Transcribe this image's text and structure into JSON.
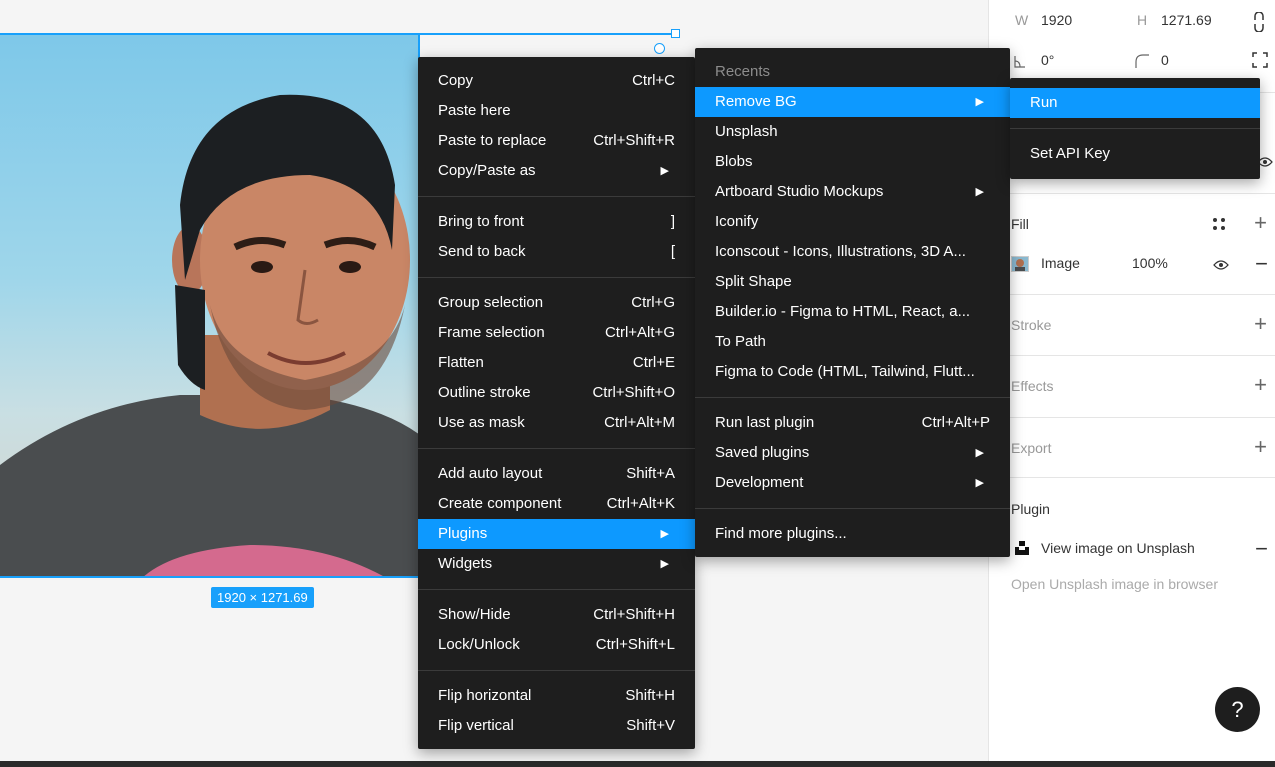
{
  "canvas": {
    "size_badge": "1920 × 1271.69"
  },
  "panel": {
    "w_label": "W",
    "w_value": "1920",
    "h_label": "H",
    "h_value": "1271.69",
    "rotation_value": "0°",
    "radius_value": "0",
    "fill_title": "Fill",
    "fill_type": "Image",
    "fill_opacity": "100%",
    "stroke_title": "Stroke",
    "effects_title": "Effects",
    "export_title": "Export",
    "plugin_title": "Plugin",
    "plugin_action": "View image on Unsplash",
    "plugin_desc": "Open Unsplash image in browser"
  },
  "help_label": "?",
  "main_menu": {
    "groups": [
      [
        {
          "label": "Copy",
          "shortcut": "Ctrl+C"
        },
        {
          "label": "Paste here",
          "shortcut": ""
        },
        {
          "label": "Paste to replace",
          "shortcut": "Ctrl+Shift+R"
        },
        {
          "label": "Copy/Paste as",
          "shortcut": "",
          "submenu": true
        }
      ],
      [
        {
          "label": "Bring to front",
          "shortcut": "]"
        },
        {
          "label": "Send to back",
          "shortcut": "["
        }
      ],
      [
        {
          "label": "Group selection",
          "shortcut": "Ctrl+G"
        },
        {
          "label": "Frame selection",
          "shortcut": "Ctrl+Alt+G"
        },
        {
          "label": "Flatten",
          "shortcut": "Ctrl+E"
        },
        {
          "label": "Outline stroke",
          "shortcut": "Ctrl+Shift+O"
        },
        {
          "label": "Use as mask",
          "shortcut": "Ctrl+Alt+M"
        }
      ],
      [
        {
          "label": "Add auto layout",
          "shortcut": "Shift+A"
        },
        {
          "label": "Create component",
          "shortcut": "Ctrl+Alt+K"
        },
        {
          "label": "Plugins",
          "shortcut": "",
          "submenu": true,
          "active": true
        },
        {
          "label": "Widgets",
          "shortcut": "",
          "submenu": true
        }
      ],
      [
        {
          "label": "Show/Hide",
          "shortcut": "Ctrl+Shift+H"
        },
        {
          "label": "Lock/Unlock",
          "shortcut": "Ctrl+Shift+L"
        }
      ],
      [
        {
          "label": "Flip horizontal",
          "shortcut": "Shift+H"
        },
        {
          "label": "Flip vertical",
          "shortcut": "Shift+V"
        }
      ]
    ]
  },
  "plugins_menu": {
    "recents_header": "Recents",
    "recents": [
      {
        "label": "Remove BG",
        "submenu": true,
        "active": true
      },
      {
        "label": "Unsplash"
      },
      {
        "label": "Blobs"
      },
      {
        "label": "Artboard Studio Mockups",
        "submenu": true
      },
      {
        "label": "Iconify"
      },
      {
        "label": "Iconscout - Icons, Illustrations, 3D A..."
      },
      {
        "label": "Split Shape"
      },
      {
        "label": "Builder.io - Figma to HTML, React, a..."
      },
      {
        "label": "To Path"
      },
      {
        "label": "Figma to Code (HTML, Tailwind, Flutt..."
      }
    ],
    "manage": [
      {
        "label": "Run last plugin",
        "shortcut": "Ctrl+Alt+P"
      },
      {
        "label": "Saved plugins",
        "submenu": true
      },
      {
        "label": "Development",
        "submenu": true
      }
    ],
    "find_more": "Find more plugins..."
  },
  "run_menu": {
    "run_label": "Run",
    "api_key_label": "Set API Key"
  }
}
